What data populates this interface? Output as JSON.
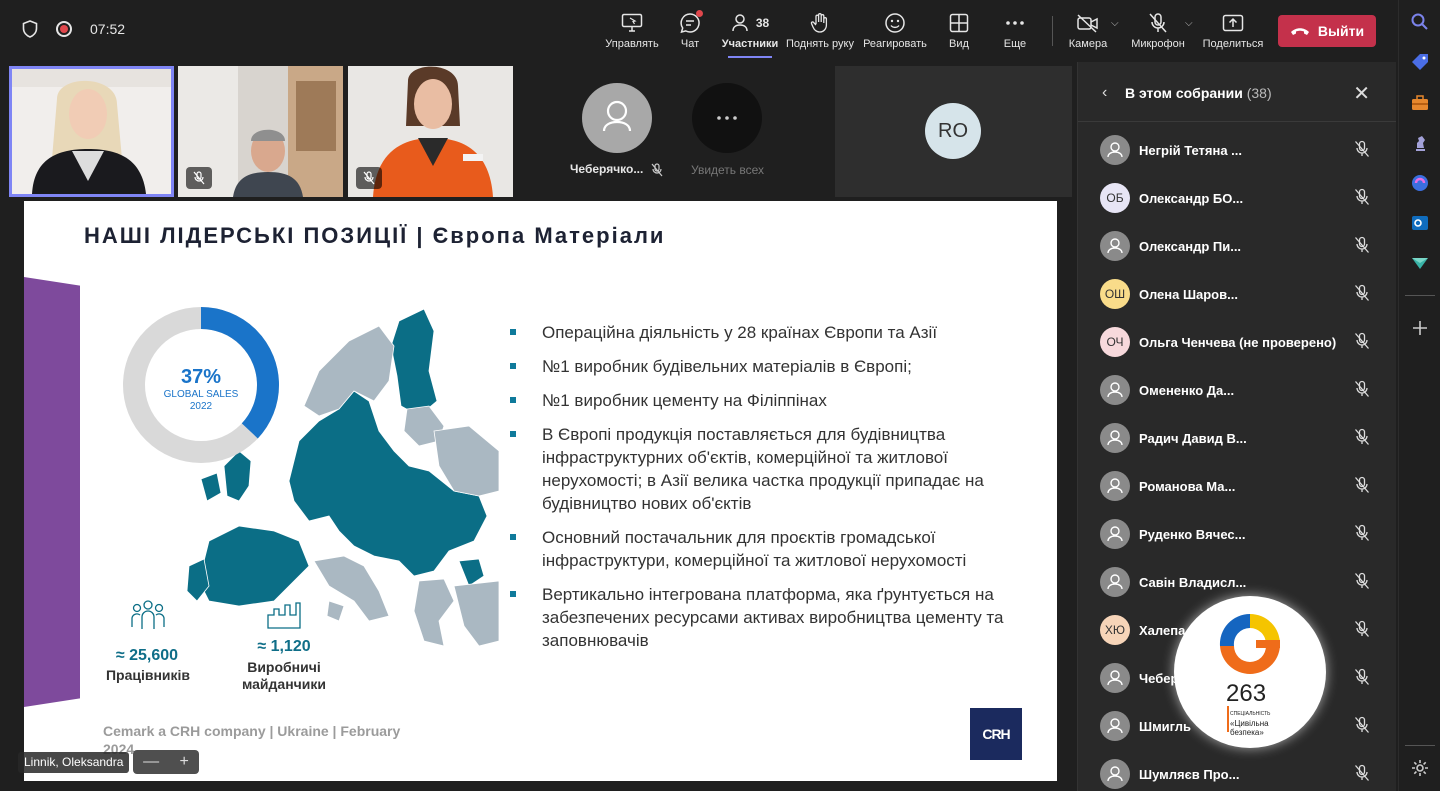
{
  "status": {
    "time": "07:52"
  },
  "toolbar": {
    "control": "Управлять",
    "chat": "Чат",
    "participants": "Участники",
    "participants_count": "38",
    "raise_hand": "Поднять руку",
    "react": "Реагировать",
    "view": "Вид",
    "more": "Еще",
    "camera": "Камера",
    "mic": "Микрофон",
    "share": "Поделиться",
    "leave": "Выйти"
  },
  "video_strip": {
    "ghost_name": "Чеберячко...",
    "see_all": "Увидеть всех",
    "ro_initials": "RO"
  },
  "slide": {
    "title": "НАШІ ЛІДЕРСЬКІ ПОЗИЦІЇ | Європа Матеріали",
    "donut": {
      "percent": "37%",
      "label1": "GLOBAL SALES",
      "label2": "2022",
      "value_fraction": 0.37
    },
    "stat_workers_value": "≈ 25,600",
    "stat_workers_label": "Працівників",
    "stat_sites_value": "≈ 1,120",
    "stat_sites_label1": "Виробничі",
    "stat_sites_label2": "майданчики",
    "bullets": [
      "Операційна діяльність у 28 країнах Європи та Азії",
      "№1 виробник будівельних матеріалів в Європі;",
      "№1 виробник цементу на Філіппінах",
      "В Європі продукція поставляється для будівництва інфраструктурних об'єктів, комерційної та житлової нерухомості; в Азії велика частка продукції припадає на будівництво нових об'єктів",
      "Основний постачальник для проєктів громадської інфраструктури, комерційної та житлової нерухомості",
      "Вертикально інтегрована платформа, яка ґрунтується на забезпечених ресурсами активах виробництва цементу та заповнювачів"
    ],
    "footer": "Cemark a CRH company | Ukraine | February 2024",
    "logo": "CRH"
  },
  "presenter_tag": "Linnik, Oleksandra",
  "zoom": {
    "minus": "—",
    "plus": "+"
  },
  "panel": {
    "title": "В этом собрании",
    "count": "(38)",
    "participants": [
      {
        "initials": "",
        "name": "Негрій Тетяна ...",
        "color": "#8a8a8a"
      },
      {
        "initials": "ОБ",
        "name": "Олександр БО...",
        "color": "#e7e5f5"
      },
      {
        "initials": "",
        "name": "Олександр Пи...",
        "color": "#8a8a8a"
      },
      {
        "initials": "ОШ",
        "name": "Олена Шаров...",
        "color": "#f9dc8a"
      },
      {
        "initials": "ОЧ",
        "name": "Ольга Ченчева (не проверено)",
        "color": "#f7d9dc"
      },
      {
        "initials": "",
        "name": "Омененко Да...",
        "color": "#8a8a8a"
      },
      {
        "initials": "",
        "name": "Радич Давид В...",
        "color": "#8a8a8a"
      },
      {
        "initials": "",
        "name": "Романова Ма...",
        "color": "#8a8a8a"
      },
      {
        "initials": "",
        "name": "Руденко Вячес...",
        "color": "#8a8a8a"
      },
      {
        "initials": "",
        "name": "Савін Владисл...",
        "color": "#8a8a8a"
      },
      {
        "initials": "ХЮ",
        "name": "Халепа",
        "color": "#f6d4b8"
      },
      {
        "initials": "",
        "name": "Чебер",
        "color": "#8a8a8a"
      },
      {
        "initials": "",
        "name": "Шмигль",
        "color": "#8a8a8a"
      },
      {
        "initials": "",
        "name": "Шумляєв Про...",
        "color": "#8a8a8a"
      }
    ]
  },
  "watermark": {
    "number": "263",
    "line1": "СПЕЦІАЛЬНІСТЬ",
    "line2": "«Цивільна",
    "line3": "безпека»"
  }
}
